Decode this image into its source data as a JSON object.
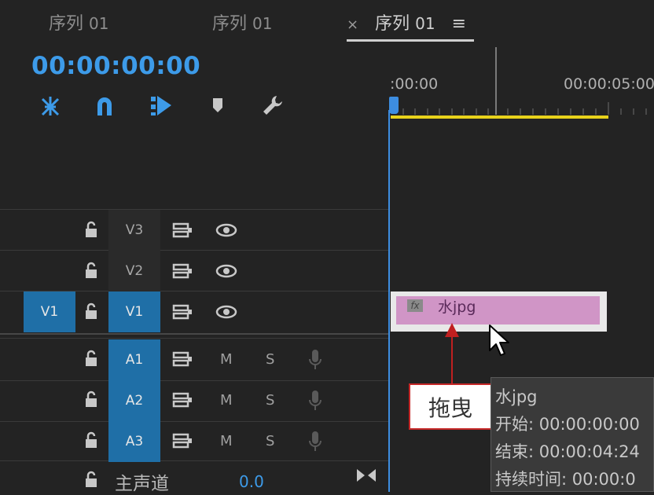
{
  "tabs": [
    {
      "prefix": "",
      "label": "序列",
      "num": "01"
    },
    {
      "prefix": "",
      "label": "序列",
      "num": "01"
    },
    {
      "prefix": "×",
      "label": "序列",
      "num": "01",
      "menu": "≡"
    }
  ],
  "timecode": "00:00:00:00",
  "ruler": {
    "start": ":00:00",
    "mark": "00:00:05:00"
  },
  "tracks": {
    "video": [
      {
        "target": "",
        "name": "V3"
      },
      {
        "target": "",
        "name": "V2"
      },
      {
        "target": "V1",
        "name": "V1"
      }
    ],
    "audio": [
      {
        "name": "A1",
        "m": "M",
        "s": "S"
      },
      {
        "name": "A2",
        "m": "M",
        "s": "S"
      },
      {
        "name": "A3",
        "m": "M",
        "s": "S"
      }
    ],
    "master": {
      "label": "主声道",
      "value": "0.0"
    }
  },
  "clip": {
    "fx": "fx",
    "name": "水jpg"
  },
  "annotation": {
    "label": "拖曳"
  },
  "tooltip": {
    "title": "水jpg",
    "start": "开始: 00:00:00:00",
    "end": "结束: 00:00:04:24",
    "duration": "持续时间: 00:00:0"
  },
  "colors": {
    "accent": "#3d9be9",
    "track_on": "#1f6fa7",
    "work_area": "#e8d21b",
    "clip": "#d095c6",
    "annotation": "#c02020"
  }
}
